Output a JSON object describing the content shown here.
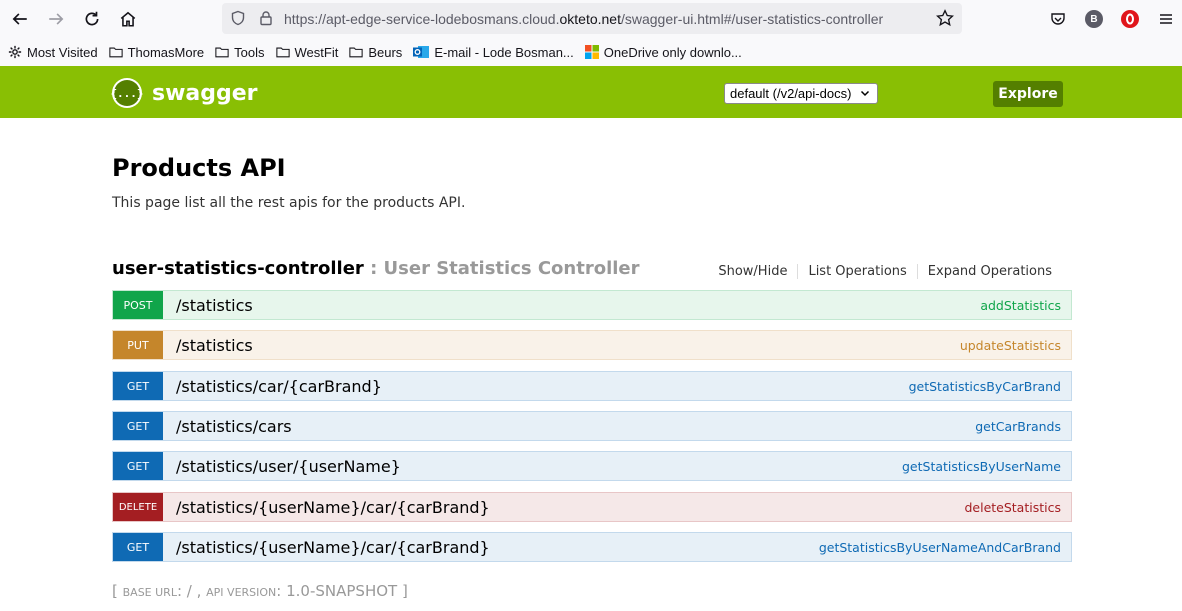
{
  "browser": {
    "url_prefix": "https://apt-edge-service-lodebosmans.cloud.",
    "url_domain": "okteto.net",
    "url_suffix": "/swagger-ui.html#/user-statistics-controller",
    "profile_initial": "B",
    "bookmarks": [
      {
        "label": "Most Visited",
        "icon": "gear-icon"
      },
      {
        "label": "ThomasMore",
        "icon": "folder-icon"
      },
      {
        "label": "Tools",
        "icon": "folder-icon"
      },
      {
        "label": "WestFit",
        "icon": "folder-icon"
      },
      {
        "label": "Beurs",
        "icon": "folder-icon"
      },
      {
        "label": "E-mail - Lode Bosman...",
        "icon": "outlook-icon"
      },
      {
        "label": "OneDrive only downlo...",
        "icon": "microsoft-icon"
      }
    ]
  },
  "swagger": {
    "logo_glyph": "{...}",
    "brand": "swagger",
    "spec_selected": "default (/v2/api-docs)",
    "explore_label": "Explore",
    "colors": {
      "header": "#89bf04",
      "button": "#547f00"
    }
  },
  "api": {
    "title": "Products API",
    "description": "This page list all the rest apis for the products API."
  },
  "controller": {
    "name": "user-statistics-controller",
    "separator": " : ",
    "description": "User Statistics Controller",
    "links": [
      "Show/Hide",
      "List Operations",
      "Expand Operations"
    ]
  },
  "operations": [
    {
      "method": "POST",
      "path": "/statistics",
      "nickname": "addStatistics",
      "color": "#10a54a"
    },
    {
      "method": "PUT",
      "path": "/statistics",
      "nickname": "updateStatistics",
      "color": "#c5862b"
    },
    {
      "method": "GET",
      "path": "/statistics/car/{carBrand}",
      "nickname": "getStatisticsByCarBrand",
      "color": "#0f6ab4"
    },
    {
      "method": "GET",
      "path": "/statistics/cars",
      "nickname": "getCarBrands",
      "color": "#0f6ab4"
    },
    {
      "method": "GET",
      "path": "/statistics/user/{userName}",
      "nickname": "getStatisticsByUserName",
      "color": "#0f6ab4"
    },
    {
      "method": "DELETE",
      "path": "/statistics/{userName}/car/{carBrand}",
      "nickname": "deleteStatistics",
      "color": "#a41e22"
    },
    {
      "method": "GET",
      "path": "/statistics/{userName}/car/{carBrand}",
      "nickname": "getStatisticsByUserNameAndCarBrand",
      "color": "#0f6ab4"
    }
  ],
  "footer": {
    "open": "[ ",
    "base_url_label": "BASE URL",
    "base_url_value": ": / , ",
    "api_version_label": "API VERSION",
    "api_version_value": ": 1.0-SNAPSHOT ",
    "close": "]"
  }
}
